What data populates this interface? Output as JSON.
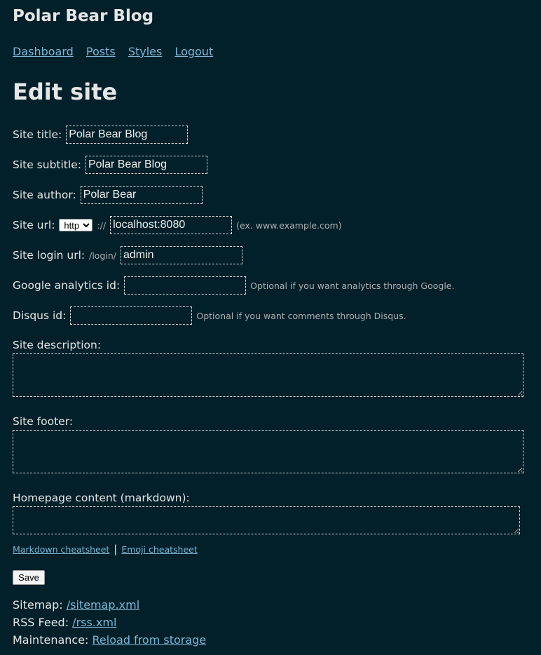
{
  "header": {
    "site_title": "Polar Bear Blog"
  },
  "nav": [
    {
      "label": "Dashboard"
    },
    {
      "label": "Posts"
    },
    {
      "label": "Styles"
    },
    {
      "label": "Logout"
    }
  ],
  "page_title": "Edit site",
  "form": {
    "site_title": {
      "label": "Site title:",
      "value": "Polar Bear Blog"
    },
    "site_subtitle": {
      "label": "Site subtitle:",
      "value": "Polar Bear Blog"
    },
    "site_author": {
      "label": "Site author:",
      "value": "Polar Bear"
    },
    "site_url": {
      "label": "Site url:",
      "scheme": "http",
      "separator": "://",
      "value": "localhost:8080",
      "hint": "(ex. www.example.com)"
    },
    "login_url": {
      "label": "Site login url:",
      "prefix": "/login/",
      "value": "admin"
    },
    "google_analytics": {
      "label": "Google analytics id:",
      "value": "",
      "hint": "Optional if you want analytics through Google."
    },
    "disqus": {
      "label": "Disqus id:",
      "value": "",
      "hint": "Optional if you want comments through Disqus."
    },
    "description": {
      "label": "Site description:",
      "value": ""
    },
    "footer": {
      "label": "Site footer:",
      "value": ""
    },
    "homepage": {
      "label": "Homepage content (markdown):",
      "value": ""
    },
    "markdown_cheatsheet": "Markdown cheatsheet",
    "link_separator": "|",
    "emoji_cheatsheet": "Emoji cheatsheet",
    "save_label": "Save"
  },
  "footer_links": {
    "sitemap": {
      "label": "Sitemap:",
      "link": "/sitemap.xml"
    },
    "rss": {
      "label": "RSS Feed:",
      "link": "/rss.xml"
    },
    "maintenance": {
      "label": "Maintenance:",
      "link": "Reload from storage"
    }
  },
  "colors": {
    "background": "#01202a",
    "text": "#e6e6e6",
    "link": "#7ab8d8",
    "hint": "#b0b0b0"
  }
}
